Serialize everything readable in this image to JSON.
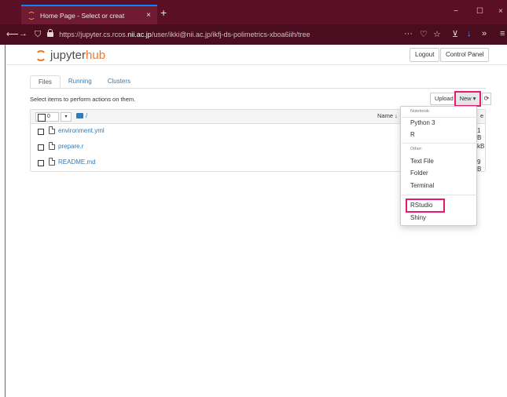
{
  "browser": {
    "tab_title": "Home Page - Select or creat",
    "tab_close": "×",
    "new_tab": "+",
    "url_prefix": "https://jupyter.cs.rcos.",
    "url_domain": "nii.ac.jp",
    "url_suffix": "/user/ikki@nii.ac.jp/ikfj-ds-polimetrics-xboa6iih/tree",
    "more": "···",
    "minimize": "−",
    "maximize": "☐",
    "close": "×"
  },
  "header": {
    "logo_prefix": "jupyter",
    "logo_suffix": "hub",
    "logout_label": "Logout",
    "control_panel_label": "Control Panel"
  },
  "tabs": [
    {
      "label": "Files"
    },
    {
      "label": "Running"
    },
    {
      "label": "Clusters"
    }
  ],
  "toolbar": {
    "hint": "Select items to perform actions on them.",
    "upload_label": "Upload",
    "new_label": "New ▾",
    "refresh": "⟳"
  },
  "list": {
    "select_count": "0",
    "path": "/",
    "name_sort": "Name ↓",
    "files": [
      {
        "name": "environment.yml",
        "size": "1 B"
      },
      {
        "name": "prepare.r",
        "size": "kB"
      },
      {
        "name": "README.md",
        "size": "9 B"
      }
    ],
    "header_size": "e"
  },
  "dropdown": {
    "notebook_header": "Notebook:",
    "python3": "Python 3",
    "r": "R",
    "other_header": "Other:",
    "text_file": "Text File",
    "folder": "Folder",
    "terminal": "Terminal",
    "rstudio": "RStudio",
    "shiny": "Shiny"
  },
  "colors": {
    "browser_tabbar": "#5a0f26",
    "browser_navbar": "#4a0c1f",
    "link": "#337ab7",
    "jupyter_orange": "#f37726",
    "highlight": "#e8196f"
  }
}
